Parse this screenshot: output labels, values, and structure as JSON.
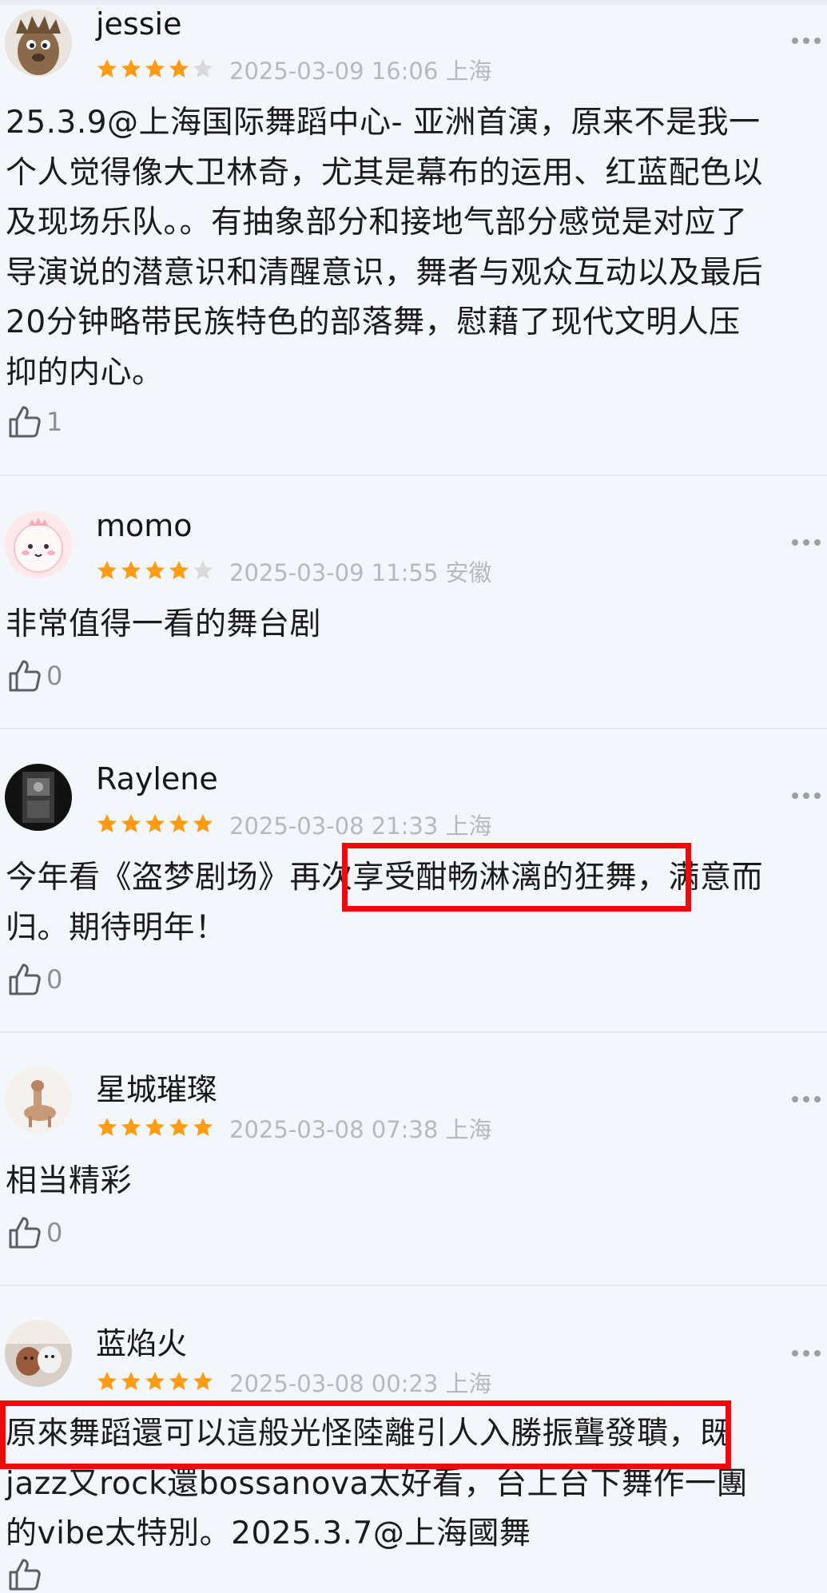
{
  "reviews": [
    {
      "username": "jessie",
      "rating": 4,
      "datetime": "2025-03-09 16:06",
      "location": "上海",
      "content_lines": [
        "25.3.9@上海国际舞蹈中心- 亚洲首演，原来不是我一",
        "个人觉得像大卫林奇，尤其是幕布的运用、红蓝配色以",
        "及现场乐队。。有抽象部分和接地气部分感觉是对应了",
        "导演说的潜意识和清醒意识，舞者与观众互动以及最后",
        "20分钟略带民族特色的部落舞，慰藉了现代文明人压",
        "抑的内心。"
      ],
      "likes": "1"
    },
    {
      "username": "momo",
      "rating": 4,
      "datetime": "2025-03-09 11:55",
      "location": "安徽",
      "content_lines": [
        "非常值得一看的舞台剧"
      ],
      "likes": "0"
    },
    {
      "username": "Raylene",
      "rating": 5,
      "datetime": "2025-03-08 21:33",
      "location": "上海",
      "content_lines": [
        "今年看《盗梦剧场》再次享受酣畅淋漓的狂舞，满意而",
        "归。期待明年！"
      ],
      "likes": "0"
    },
    {
      "username": "星城璀璨",
      "rating": 5,
      "datetime": "2025-03-08 07:38",
      "location": "上海",
      "content_lines": [
        "相当精彩"
      ],
      "likes": "0"
    },
    {
      "username": "蓝焰火",
      "rating": 5,
      "datetime": "2025-03-08 00:23",
      "location": "上海",
      "content_lines": [
        "原來舞蹈還可以這般光怪陸離引人入勝振聾發聵，既",
        "jazz又rock還bossanova太好看，台上台下舞作一團",
        "的vibe太特別。2025.3.7@上海國舞"
      ],
      "likes": ""
    }
  ],
  "colors": {
    "background": "#f3f6fa",
    "star_filled": "#ff9c14",
    "star_empty": "#d9d9d9",
    "highlight_box": "#f20a0a",
    "meta_text": "#b6b9bf"
  },
  "icons": {
    "like": "thumbs-up-outline-icon",
    "more": "more-dots-icon",
    "star": "star-icon"
  }
}
